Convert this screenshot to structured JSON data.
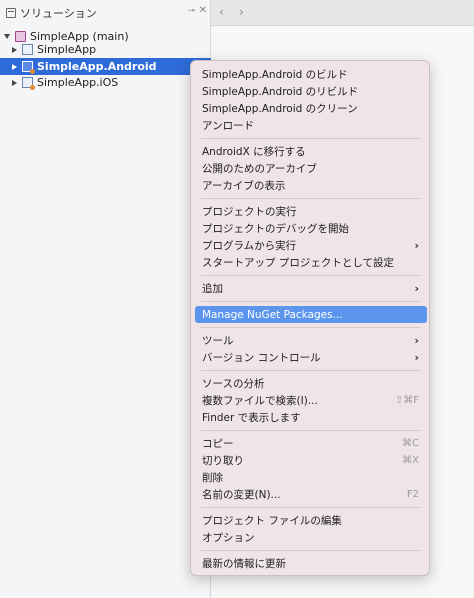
{
  "solution_pad": {
    "title": "ソリューション",
    "pin_icon": "pin-icon",
    "close_label": "✕",
    "tree": [
      {
        "label": "SimpleApp (main)",
        "kind": "solution",
        "expanded": true
      },
      {
        "label": "SimpleApp",
        "kind": "project"
      },
      {
        "label": "SimpleApp.Android",
        "kind": "project",
        "selected": true
      },
      {
        "label": "SimpleApp.iOS",
        "kind": "project"
      }
    ]
  },
  "editor": {
    "back_label": "‹",
    "forward_label": "›"
  },
  "context_menu": {
    "items": [
      {
        "label": "SimpleApp.Android のビルド"
      },
      {
        "label": "SimpleApp.Android のリビルド"
      },
      {
        "label": "SimpleApp.Android のクリーン"
      },
      {
        "label": "アンロード"
      },
      {
        "label": "AndroidX に移行する"
      },
      {
        "label": "公開のためのアーカイブ"
      },
      {
        "label": "アーカイブの表示"
      },
      {
        "label": "プロジェクトの実行"
      },
      {
        "label": "プロジェクトのデバッグを開始"
      },
      {
        "label": "プログラムから実行",
        "submenu": "›"
      },
      {
        "label": "スタートアップ プロジェクトとして設定"
      },
      {
        "label": "追加",
        "submenu": "›"
      },
      {
        "label": "Manage NuGet Packages...",
        "highlighted": true
      },
      {
        "label": "ツール",
        "submenu": "›"
      },
      {
        "label": "バージョン コントロール",
        "submenu": "›"
      },
      {
        "label": "ソースの分析"
      },
      {
        "label": "複数ファイルで検索(I)...",
        "shortcut": "⇧⌘F"
      },
      {
        "label": "Finder で表示します"
      },
      {
        "label": "コピー",
        "shortcut": "⌘C"
      },
      {
        "label": "切り取り",
        "shortcut": "⌘X"
      },
      {
        "label": "削除"
      },
      {
        "label": "名前の変更(N)...",
        "shortcut": "F2"
      },
      {
        "label": "プロジェクト ファイルの編集"
      },
      {
        "label": "オプション"
      },
      {
        "label": "最新の情報に更新"
      }
    ]
  }
}
